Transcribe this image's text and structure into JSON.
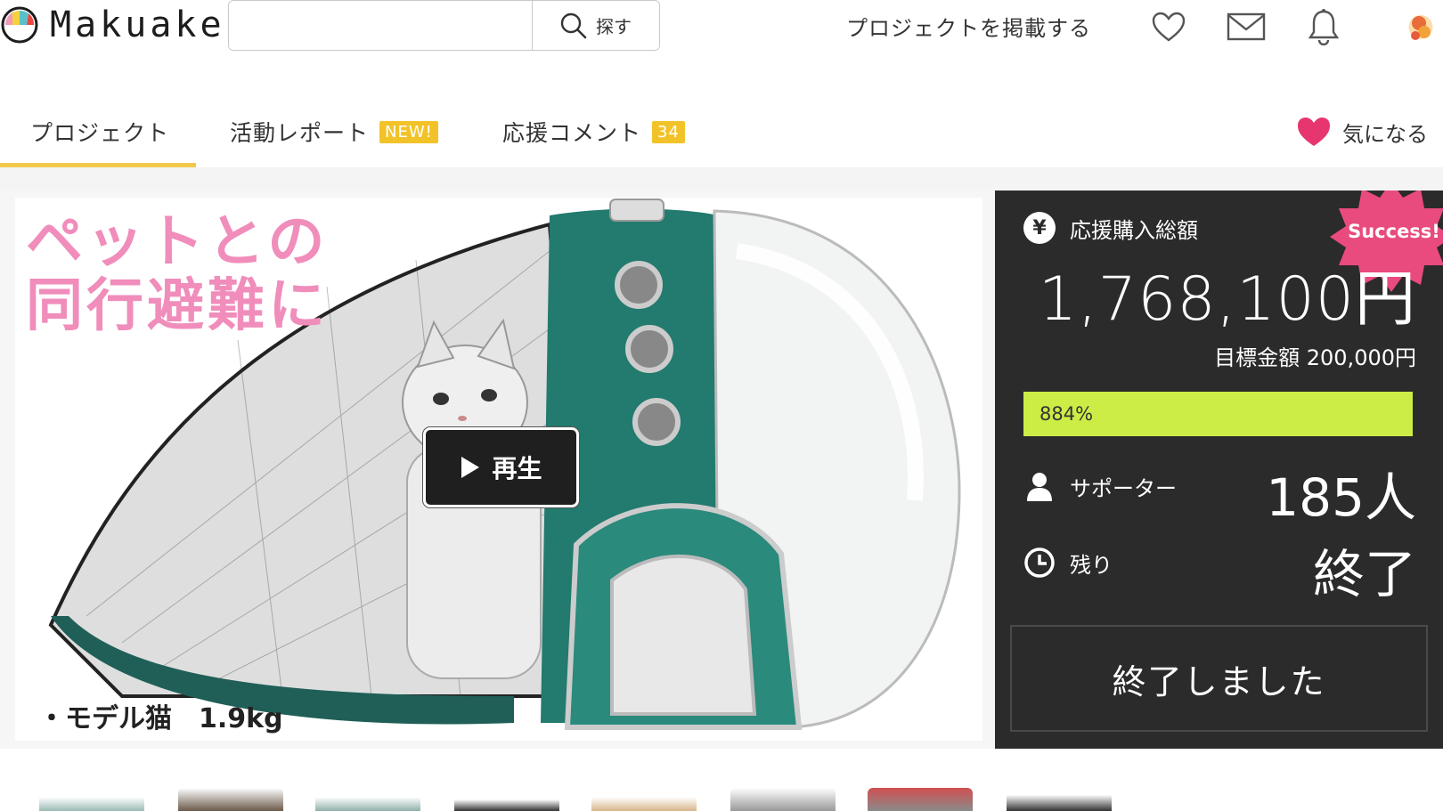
{
  "header": {
    "logo_text": "Makuake",
    "search_placeholder": "",
    "search_button": "探す",
    "post_project": "プロジェクトを掲載する",
    "icons": [
      "heart-icon",
      "mail-icon",
      "bell-icon"
    ]
  },
  "tabs": [
    {
      "label": "プロジェクト",
      "active": true
    },
    {
      "label": "活動レポート",
      "badge": "NEW!"
    },
    {
      "label": "応援コメント",
      "badge": "34"
    }
  ],
  "favorite": {
    "label": "気になる"
  },
  "visual": {
    "headline_line1": "ペットとの",
    "headline_line2": "同行避難に",
    "caption": "・モデル猫　1.9kg",
    "play_label": "再生"
  },
  "stats": {
    "success_badge": "Success!",
    "total_label": "応援購入総額",
    "total_value": "1,768,100円",
    "goal_text": "目標金額 200,000円",
    "progress_text": "884%",
    "progress_fraction": 1.0,
    "supporters_label": "サポーター",
    "supporters_value": "185人",
    "remaining_label": "残り",
    "remaining_value": "終了",
    "ended_button": "終了しました"
  },
  "colors": {
    "accent_yellow": "#f2c94c",
    "panel_bg": "#2b2b2b",
    "progress_green": "#ccec46",
    "success_pink": "#e94b7e",
    "fav_pink": "#e6356f",
    "headline_pink": "#f08dbb"
  }
}
